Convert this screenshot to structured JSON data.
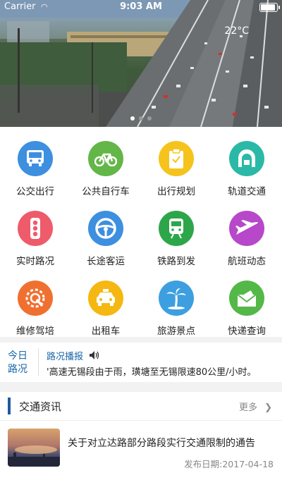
{
  "status_bar": {
    "carrier": "Carrier",
    "time": "9:03 AM",
    "battery_level": 1.0
  },
  "banner": {
    "temperature": "22°C",
    "slides": 3,
    "active_slide": 1
  },
  "services": [
    {
      "label": "公交出行",
      "icon": "bus-icon",
      "color": "#3d8fe0"
    },
    {
      "label": "公共自行车",
      "icon": "bicycle-icon",
      "color": "#63b648"
    },
    {
      "label": "出行规划",
      "icon": "clipboard-icon",
      "color": "#f5c31c"
    },
    {
      "label": "轨道交通",
      "icon": "tunnel-icon",
      "color": "#2bb9a7"
    },
    {
      "label": "实时路况",
      "icon": "traffic-light-icon",
      "color": "#ee5b6a"
    },
    {
      "label": "长途客运",
      "icon": "steering-wheel-icon",
      "color": "#3d8fe0"
    },
    {
      "label": "铁路到发",
      "icon": "train-icon",
      "color": "#2da64a"
    },
    {
      "label": "航班动态",
      "icon": "airplane-icon",
      "color": "#b748c9"
    },
    {
      "label": "维修驾培",
      "icon": "repair-icon",
      "color": "#f07030"
    },
    {
      "label": "出租车",
      "icon": "taxi-icon",
      "color": "#f5b812"
    },
    {
      "label": "旅游景点",
      "icon": "palm-tree-icon",
      "color": "#3d9fe0"
    },
    {
      "label": "快递查询",
      "icon": "envelope-icon",
      "color": "#54b848"
    }
  ],
  "ticker": {
    "heading": "今日路况",
    "title": "路况播报",
    "text": "'高速无锡段由于雨，璜塘至无锡限速80公里/小时。"
  },
  "section": {
    "title": "交通资讯",
    "more_label": "更多",
    "articles": [
      {
        "title": "关于对立达路部分路段实行交通限制的通告",
        "date": "发布日期:2017-04-18"
      }
    ]
  },
  "colors": {
    "accent": "#1e5aa0",
    "link": "#1a66a8"
  }
}
